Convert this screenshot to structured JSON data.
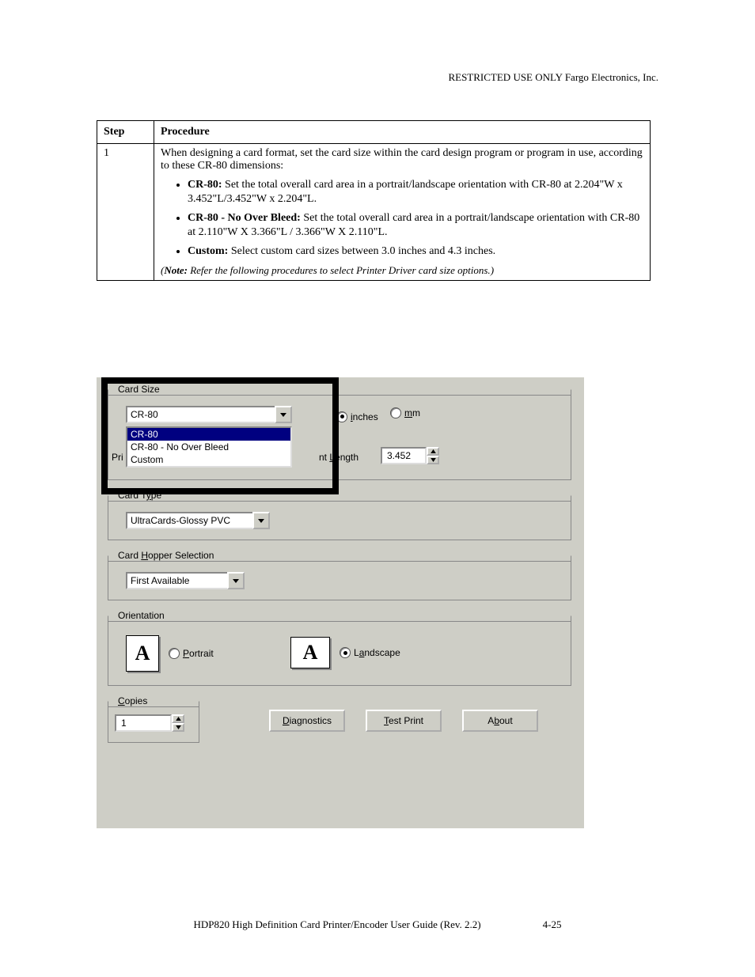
{
  "doc": {
    "header": "RESTRICTED USE ONLY                                                                         Fargo Electronics, Inc.",
    "footer": "HDP820 High Definition Card Printer/Encoder User Guide (Rev. 2.2)"
  },
  "table": {
    "step_label": "Step",
    "procedure_label": "Procedure",
    "step_value": "1",
    "intro": "When designing a card format, set the card size within the card design program or program in use, according to these CR-80 dimensions:",
    "bullets": [
      {
        "lead": "CR-80:",
        "text": " Set the total overall card area in a portrait/landscape orientation with CR-80 at 2.204\"W x 3.452\"L/3.452\"W x 2.204\"L."
      },
      {
        "lead": "CR-80 - No Over Bleed:",
        "text": " Set the total overall card area in a portrait/landscape orientation with CR-80 at 2.110\"W X 3.366\"L / 3.366\"W X 2.110\"L."
      },
      {
        "lead": "Custom:",
        "text": " Select custom card sizes between 3.0 inches and 4.3 inches."
      }
    ],
    "note_lead": "Note:",
    "note_text": " Refer the following procedures to select Printer Driver card size options."
  },
  "panel": {
    "card_size": {
      "legend": "Card Size",
      "dropdown_value": "CR-80",
      "options": [
        "CR-80",
        "CR-80 - No Over Bleed",
        "Custom"
      ],
      "unit_inches": "inches",
      "unit_mm": "mm",
      "print_prefix": "Pri",
      "length_label_fragment": "nt Length",
      "length_value": "3.452"
    },
    "card_type": {
      "legend": "Card Type",
      "value": "UltraCards-Glossy PVC"
    },
    "hopper": {
      "legend": "Card Hopper Selection",
      "value": "First Available"
    },
    "orientation": {
      "legend": "Orientation",
      "portrait": "Portrait",
      "landscape": "Landscape"
    },
    "copies": {
      "legend": "Copies",
      "value": "1"
    },
    "buttons": {
      "diagnostics": "Diagnostics",
      "test_print": "Test Print",
      "about": "About"
    }
  },
  "page_no": "4-25"
}
